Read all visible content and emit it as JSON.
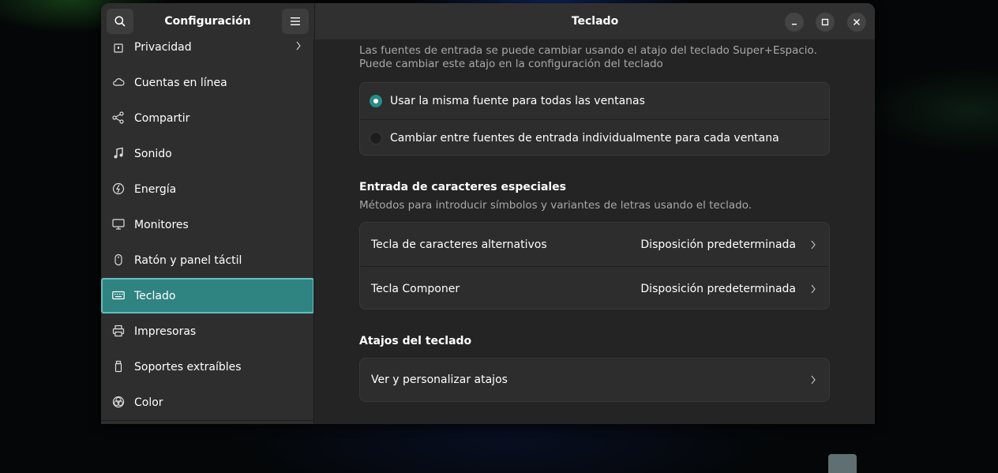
{
  "header": {
    "sidebar_title": "Configuración",
    "content_title": "Teclado"
  },
  "sidebar": {
    "items": [
      {
        "label": "Privacidad",
        "icon": "hand-lock-icon"
      },
      {
        "label": "Cuentas en línea",
        "icon": "cloud-icon"
      },
      {
        "label": "Compartir",
        "icon": "share-icon"
      },
      {
        "label": "Sonido",
        "icon": "music-note-icon"
      },
      {
        "label": "Energía",
        "icon": "power-icon"
      },
      {
        "label": "Monitores",
        "icon": "monitor-icon"
      },
      {
        "label": "Ratón y panel táctil",
        "icon": "mouse-icon"
      },
      {
        "label": "Teclado",
        "icon": "keyboard-icon"
      },
      {
        "label": "Impresoras",
        "icon": "printer-icon"
      },
      {
        "label": "Soportes extraíbles",
        "icon": "removable-media-icon"
      },
      {
        "label": "Color",
        "icon": "color-icon"
      }
    ],
    "active": "Teclado"
  },
  "input_sources": {
    "description": "Las fuentes de entrada se puede cambiar usando el atajo del teclado Super+Espacio. Puede cambiar este atajo en la configuración del teclado",
    "description_line1": "Las fuentes de entrada se puede cambiar usando el atajo del teclado Super+Espacio.",
    "description_line2": "Puede cambiar este atajo en la configuración del teclado",
    "options": [
      {
        "label": "Usar la misma fuente para todas las ventanas",
        "selected": true
      },
      {
        "label": "Cambiar entre fuentes de entrada individualmente para cada ventana",
        "selected": false
      }
    ]
  },
  "special_chars": {
    "title": "Entrada de caracteres especiales",
    "description": "Métodos para introducir símbolos y variantes de letras usando el teclado.",
    "rows": [
      {
        "label": "Tecla de caracteres alternativos",
        "value": "Disposición predeterminada"
      },
      {
        "label": "Tecla Componer",
        "value": "Disposición predeterminada"
      }
    ]
  },
  "shortcuts": {
    "title": "Atajos del teclado",
    "row_label": "Ver y personalizar atajos"
  },
  "colors": {
    "accent": "#2f8381",
    "accent_border": "#5fc1bd",
    "window_bg": "#242424",
    "sidebar_bg": "#2e2e2e",
    "card_bg": "#2d2d2d"
  }
}
